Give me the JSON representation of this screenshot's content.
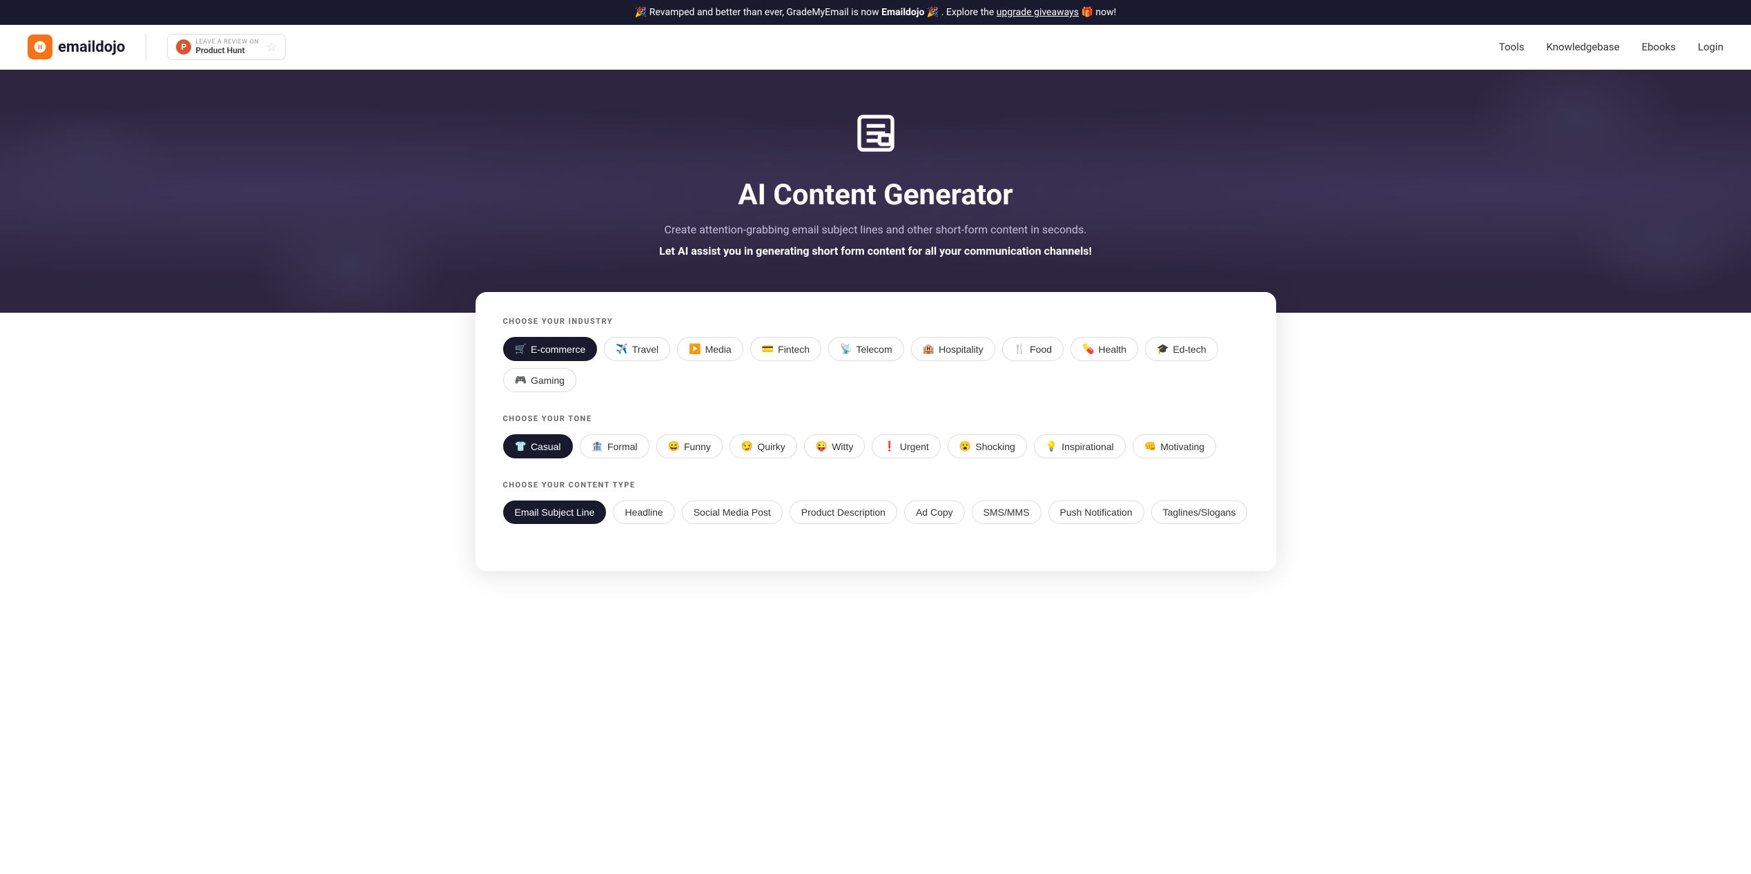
{
  "announcement": {
    "text_before": "🎉 Revamped and better than ever, GradeMyEmail is now ",
    "brand": "Emaildojo",
    "text_after": " 🎉 . Explore the ",
    "link_text": "upgrade giveaways",
    "text_end": " 🎁 now!"
  },
  "header": {
    "logo_text": "emaildojo",
    "logo_icon": "⚡",
    "product_hunt": {
      "label": "LEAVE A REVIEW ON",
      "name": "Product Hunt",
      "icon": "P"
    },
    "nav": {
      "tools": "Tools",
      "knowledgebase": "Knowledgebase",
      "ebooks": "Ebooks",
      "login": "Login"
    }
  },
  "hero": {
    "title": "AI Content Generator",
    "subtitle": "Create attention-grabbing email subject lines and other short-form content in seconds.",
    "emphasis": "Let AI assist you in generating short form content for all your communication channels!"
  },
  "card": {
    "industry": {
      "label": "CHOOSE YOUR INDUSTRY",
      "options": [
        {
          "id": "ecommerce",
          "icon": "🛒",
          "label": "E-commerce",
          "active": true
        },
        {
          "id": "travel",
          "icon": "✈️",
          "label": "Travel",
          "active": false
        },
        {
          "id": "media",
          "icon": "▶️",
          "label": "Media",
          "active": false
        },
        {
          "id": "fintech",
          "icon": "💳",
          "label": "Fintech",
          "active": false
        },
        {
          "id": "telecom",
          "icon": "📡",
          "label": "Telecom",
          "active": false
        },
        {
          "id": "hospitality",
          "icon": "🏨",
          "label": "Hospitality",
          "active": false
        },
        {
          "id": "food",
          "icon": "🍴",
          "label": "Food",
          "active": false
        },
        {
          "id": "health",
          "icon": "💊",
          "label": "Health",
          "active": false
        },
        {
          "id": "edtech",
          "icon": "🎓",
          "label": "Ed-tech",
          "active": false
        },
        {
          "id": "gaming",
          "icon": "🎮",
          "label": "Gaming",
          "active": false
        }
      ]
    },
    "tone": {
      "label": "CHOOSE YOUR TONE",
      "options": [
        {
          "id": "casual",
          "icon": "👕",
          "label": "Casual",
          "active": true
        },
        {
          "id": "formal",
          "icon": "🏦",
          "label": "Formal",
          "active": false
        },
        {
          "id": "funny",
          "icon": "😄",
          "label": "Funny",
          "active": false
        },
        {
          "id": "quirky",
          "icon": "😏",
          "label": "Quirky",
          "active": false
        },
        {
          "id": "witty",
          "icon": "😜",
          "label": "Witty",
          "active": false
        },
        {
          "id": "urgent",
          "icon": "❗",
          "label": "Urgent",
          "active": false
        },
        {
          "id": "shocking",
          "icon": "😮",
          "label": "Shocking",
          "active": false
        },
        {
          "id": "inspirational",
          "icon": "💡",
          "label": "Inspirational",
          "active": false
        },
        {
          "id": "motivating",
          "icon": "👊",
          "label": "Motivating",
          "active": false
        }
      ]
    },
    "content_type": {
      "label": "CHOOSE YOUR CONTENT TYPE",
      "options": [
        {
          "id": "email_subject",
          "label": "Email Subject Line",
          "active": true
        },
        {
          "id": "headline",
          "label": "Headline",
          "active": false
        },
        {
          "id": "social_media",
          "label": "Social Media Post",
          "active": false
        },
        {
          "id": "product_desc",
          "label": "Product Description",
          "active": false
        },
        {
          "id": "ad_copy",
          "label": "Ad Copy",
          "active": false
        },
        {
          "id": "sms",
          "label": "SMS/MMS",
          "active": false
        },
        {
          "id": "push_notif",
          "label": "Push Notification",
          "active": false
        },
        {
          "id": "taglines",
          "label": "Taglines/Slogans",
          "active": false
        }
      ]
    }
  }
}
